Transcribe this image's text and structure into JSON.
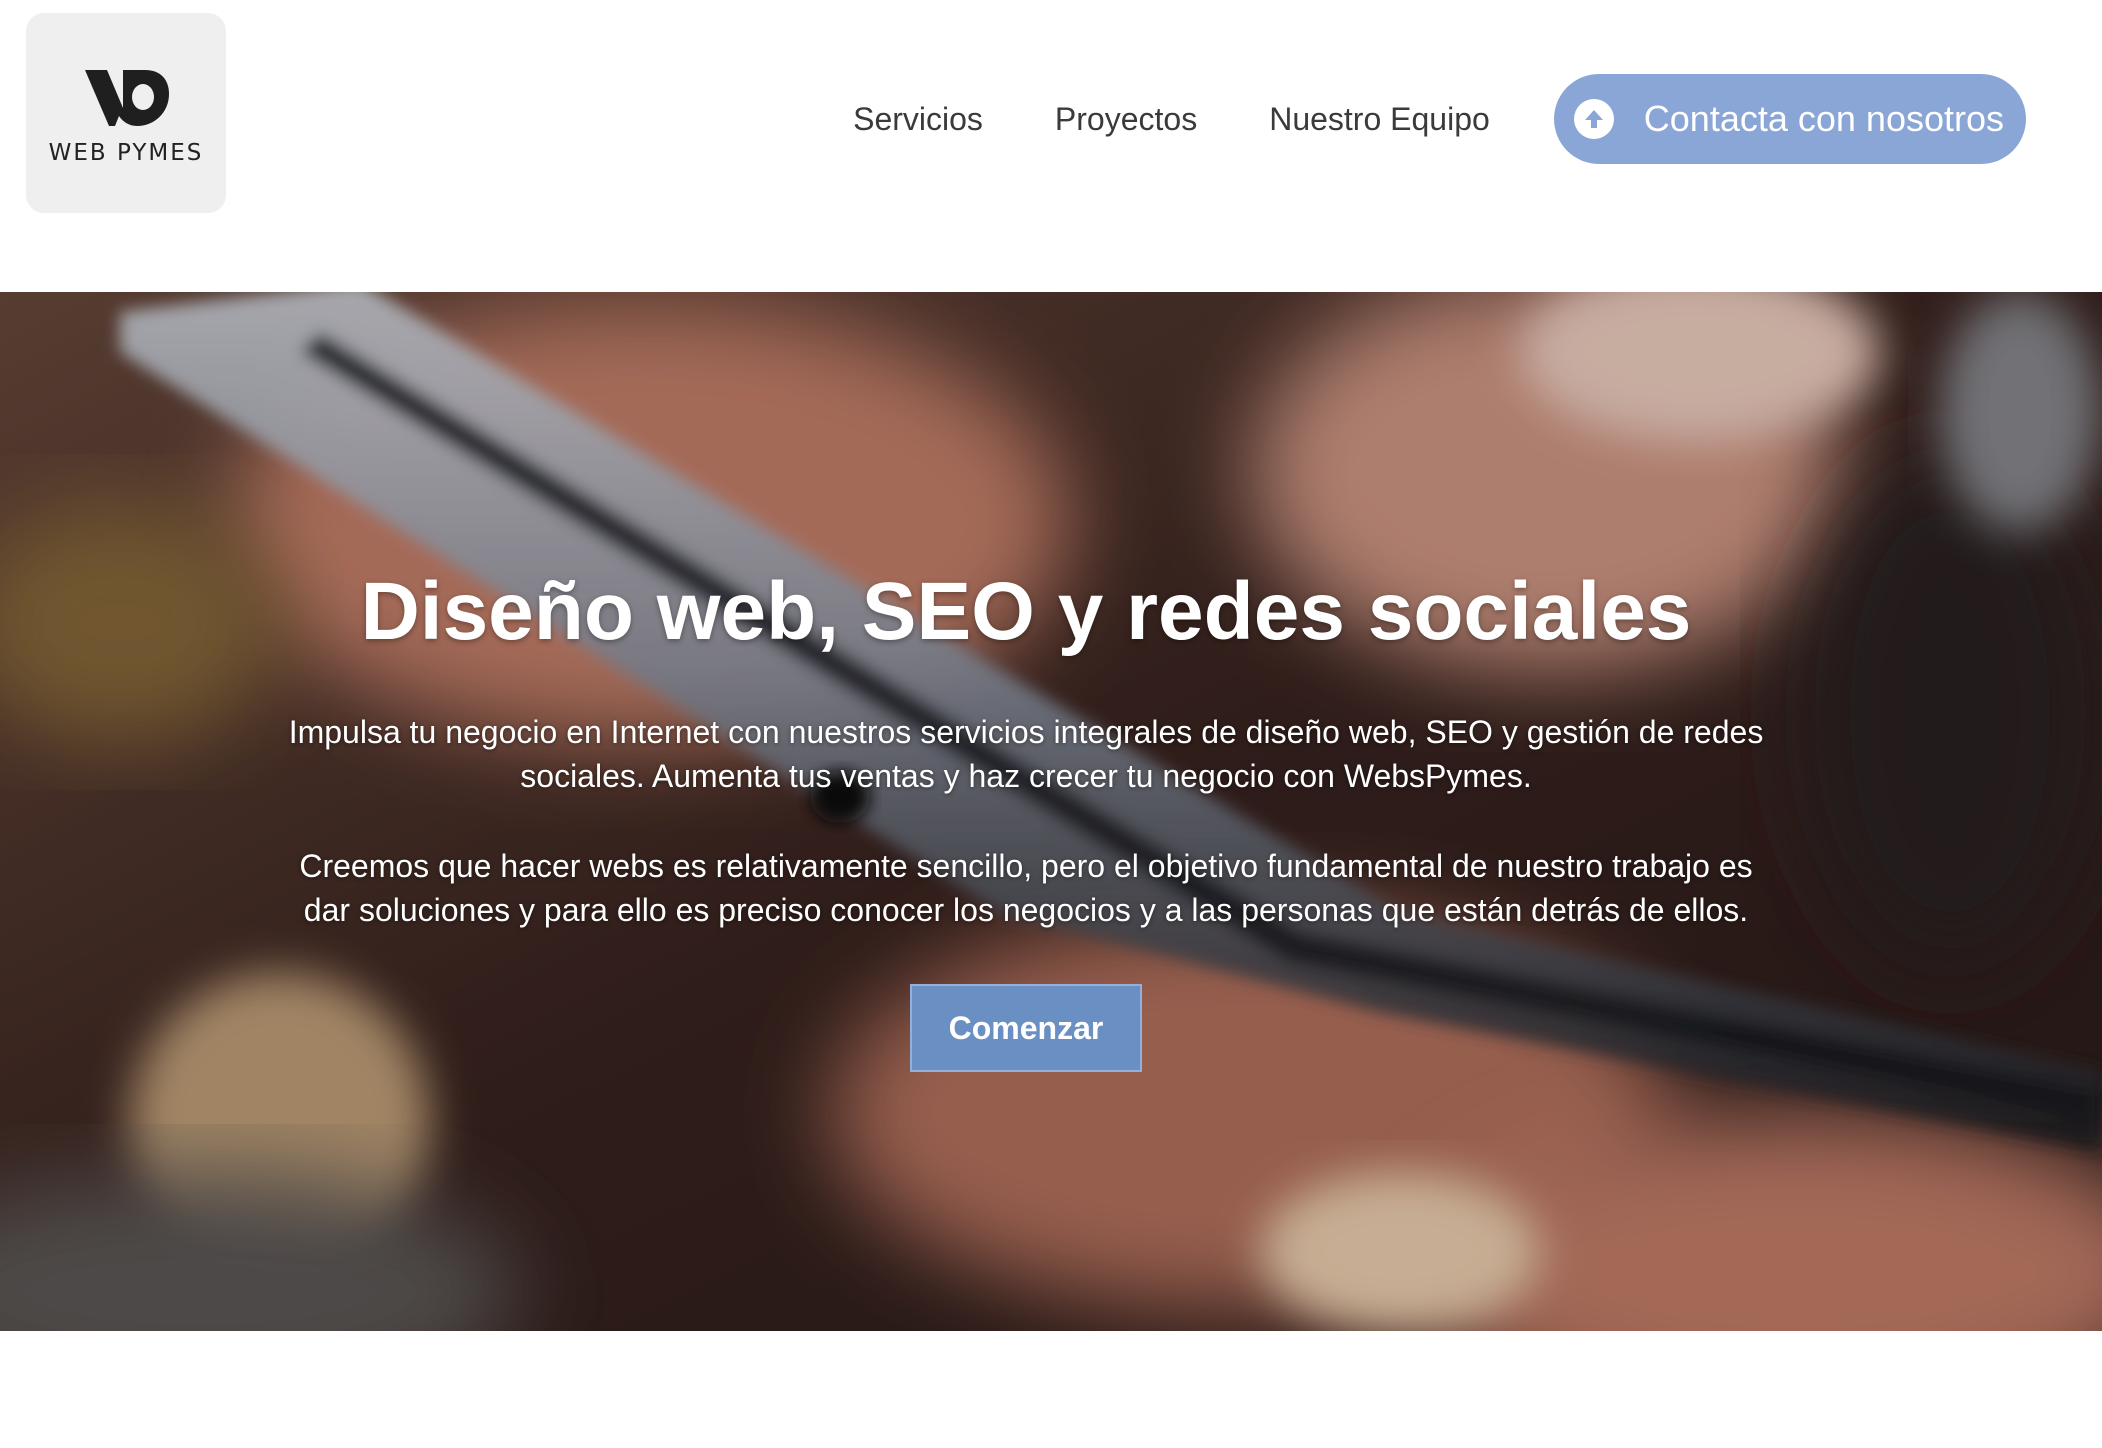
{
  "brand": {
    "logo_icon": "wp-monogram-icon",
    "name": "WEB PYMES"
  },
  "nav": {
    "items": [
      {
        "label": "Servicios"
      },
      {
        "label": "Proyectos"
      },
      {
        "label": "Nuestro Equipo"
      }
    ],
    "cta": {
      "label": "Contacta con nosotros",
      "icon": "arrow-up-circle-icon",
      "color": "#8aa6d6"
    }
  },
  "hero": {
    "title": "Diseño web, SEO y redes sociales",
    "paragraph_1": "Impulsa tu negocio en Internet con nuestros servicios integrales de diseño web, SEO y gestión de redes sociales. Aumenta tus ventas y haz crecer tu negocio con WebsPymes.",
    "paragraph_2": "Creemos que hacer webs es relativamente sencillo, pero el objetivo fundamental de nuestro trabajo es dar soluciones y para ello es preciso conocer los negocios y a las personas que están detrás de ellos.",
    "button_label": "Comenzar",
    "button_color": "#6a8fc2",
    "background_image": "blurred-hand-holding-smartphone"
  }
}
